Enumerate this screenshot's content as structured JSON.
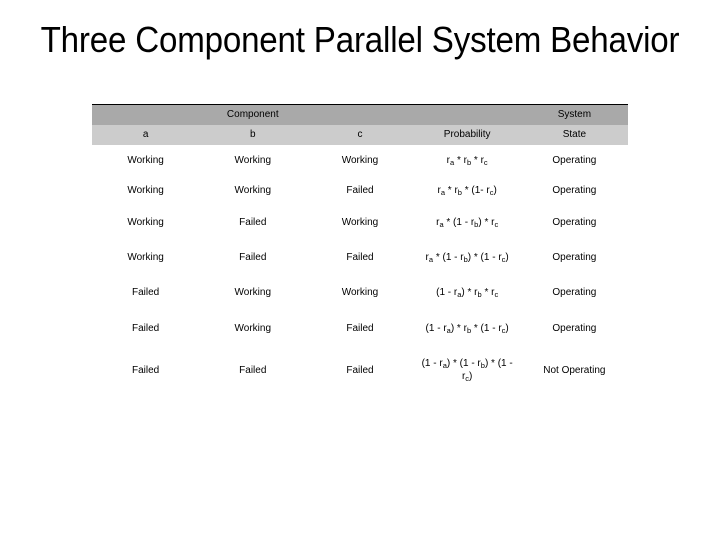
{
  "slide": {
    "title": "Three Component Parallel System Behavior"
  },
  "table": {
    "group_headers": {
      "component": "Component",
      "system": "System"
    },
    "columns": [
      "a",
      "b",
      "c",
      "Probability",
      "State"
    ],
    "rows": [
      {
        "a": "Working",
        "b": "Working",
        "c": "Working",
        "probability": "r<sub>a</sub> * r<sub>b</sub> * r<sub>c</sub>",
        "probability_text": "ra * rb * rc",
        "state": "Operating"
      },
      {
        "a": "Working",
        "b": "Working",
        "c": "Failed",
        "probability": "r<sub>a</sub> * r<sub>b</sub> * (1- r<sub>c</sub>)",
        "probability_text": "ra * rb * (1- rc)",
        "state": "Operating"
      },
      {
        "a": "Working",
        "b": "Failed",
        "c": "Working",
        "probability": "r<sub>a</sub> * (1 - r<sub>b</sub>) * r<sub>c</sub>",
        "probability_text": "ra * (1 - rb) * rc",
        "state": "Operating"
      },
      {
        "a": "Working",
        "b": "Failed",
        "c": "Failed",
        "probability": "r<sub>a</sub> * (1 - r<sub>b</sub>) * (1 - r<sub>c</sub>)",
        "probability_text": "ra * (1 - rb) * (1 - rc)",
        "state": "Operating"
      },
      {
        "a": "Failed",
        "b": "Working",
        "c": "Working",
        "probability": "(1 - r<sub>a</sub>) * r<sub>b</sub> * r<sub>c</sub>",
        "probability_text": "(1 - ra) * rb * rc",
        "state": "Operating"
      },
      {
        "a": "Failed",
        "b": "Working",
        "c": "Failed",
        "probability": "(1 - r<sub>a</sub>) * r<sub>b</sub> * (1 - r<sub>c</sub>)",
        "probability_text": "(1 - ra) * rb * (1 - rc)",
        "state": "Operating"
      },
      {
        "a": "Failed",
        "b": "Failed",
        "c": "Failed",
        "probability": "(1 - r<sub>a</sub>) * (1 - r<sub>b</sub>) * (1 - r<sub>c</sub>)",
        "probability_text": "(1 - ra) * (1 - rb) * (1 - rc)",
        "state": "Not Operating"
      }
    ]
  },
  "colors": {
    "header_group_bg": "#a9a9a9",
    "header_sub_bg": "#cccccc",
    "body_bg": "#ffffff",
    "text": "#000000",
    "top_border": "#000000"
  }
}
